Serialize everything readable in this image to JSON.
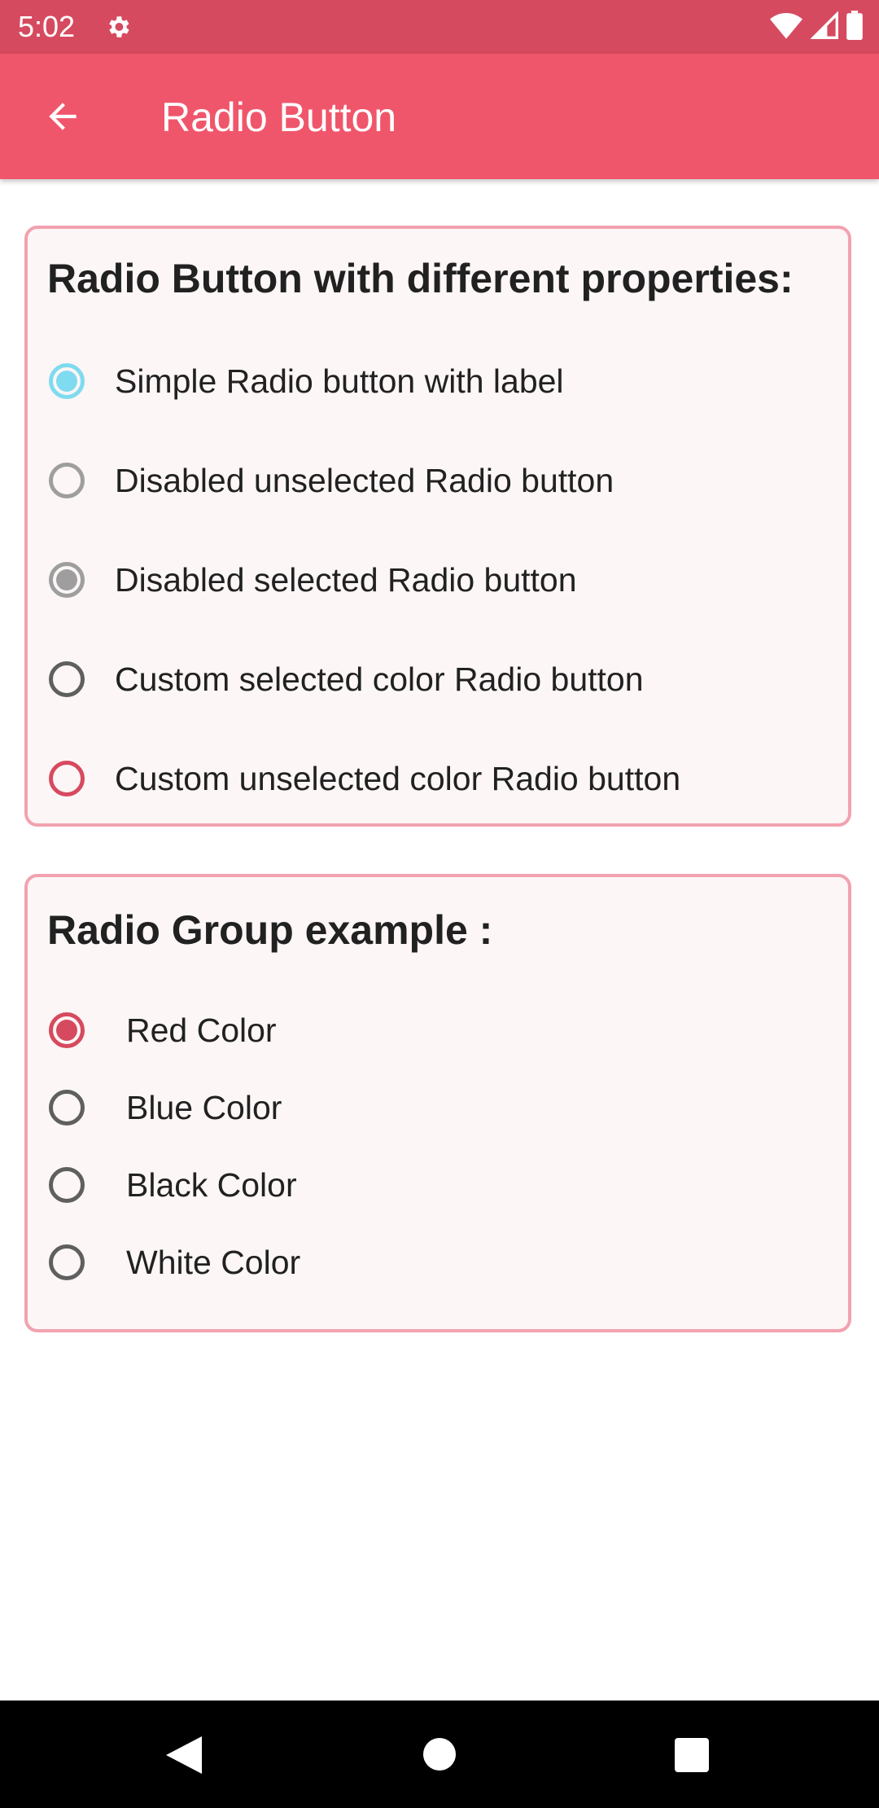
{
  "status_bar": {
    "time": "5:02",
    "icons": [
      "settings-gear-icon",
      "wifi-icon",
      "signal-icon",
      "battery-icon"
    ]
  },
  "app_bar": {
    "title": "Radio Button",
    "back_icon": "arrow-left-icon",
    "color": "#f0566b"
  },
  "properties_card": {
    "title": "Radio Button with different properties:",
    "items": [
      {
        "label": "Simple Radio button with label",
        "selected": true,
        "state": "selected-accent",
        "color": "#7fdbef"
      },
      {
        "label": "Disabled unselected Radio button",
        "selected": false,
        "state": "disabled",
        "color": "#9e9e9e"
      },
      {
        "label": "Disabled selected Radio button",
        "selected": true,
        "state": "disabled",
        "color": "#9e9e9e"
      },
      {
        "label": "Custom selected color Radio button",
        "selected": false,
        "state": "normal",
        "color": "#5f5f5f"
      },
      {
        "label": "Custom unselected color Radio button",
        "selected": false,
        "state": "custom",
        "color": "#d64a5f"
      }
    ]
  },
  "group_card": {
    "title": "Radio Group example :",
    "items": [
      {
        "label": "Red Color",
        "selected": true,
        "color": "#d64a5f"
      },
      {
        "label": "Blue Color",
        "selected": false,
        "color": "#5f5f5f"
      },
      {
        "label": "Black Color",
        "selected": false,
        "color": "#5f5f5f"
      },
      {
        "label": "White Color",
        "selected": false,
        "color": "#5f5f5f"
      }
    ]
  },
  "nav_bar": {
    "icons": [
      "nav-back-icon",
      "nav-home-icon",
      "nav-recents-icon"
    ]
  },
  "colors": {
    "status_bar": "#d64a5f",
    "card_border": "#f2a2b0",
    "card_background": "#fdf6f6"
  }
}
